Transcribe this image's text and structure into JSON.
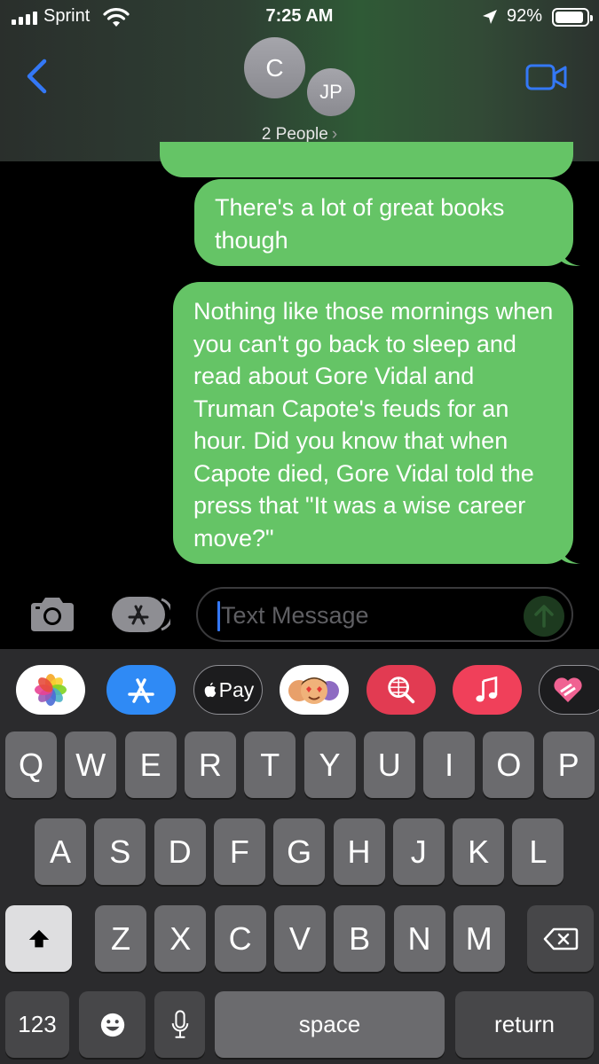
{
  "status_bar": {
    "carrier": "Sprint",
    "time": "7:25 AM",
    "battery_percent": "92%",
    "battery_level": 0.92
  },
  "conversation": {
    "avatar_c": "C",
    "avatar_jp": "JP",
    "people_label": "2 People",
    "people_chevron": "›"
  },
  "messages": [
    {
      "text": "There's a lot of great books though"
    },
    {
      "text": "Nothing like those mornings when you can't go back to sleep and read about Gore Vidal and Truman Capote's feuds for an hour. Did you know that when Capote died, Gore Vidal told the press that \"It was a wise career move?\""
    }
  ],
  "input": {
    "placeholder": "Text Message"
  },
  "apps": {
    "apple_pay": "Pay"
  },
  "keyboard": {
    "row1": [
      "Q",
      "W",
      "E",
      "R",
      "T",
      "Y",
      "U",
      "I",
      "O",
      "P"
    ],
    "row2": [
      "A",
      "S",
      "D",
      "F",
      "G",
      "H",
      "J",
      "K",
      "L"
    ],
    "row3": [
      "Z",
      "X",
      "C",
      "V",
      "B",
      "N",
      "M"
    ],
    "numbers": "123",
    "space": "space",
    "return": "return"
  },
  "colors": {
    "bubble": "#65c466",
    "accent": "#3478f6"
  },
  "icons": [
    "signal-icon",
    "wifi-icon",
    "location-icon",
    "battery-icon",
    "back-chevron-icon",
    "video-call-icon",
    "camera-icon",
    "app-store-icon",
    "send-arrow-icon",
    "photos-icon",
    "memoji-icon",
    "search-images-icon",
    "music-icon",
    "heart-icon",
    "shift-icon",
    "delete-icon",
    "emoji-icon",
    "microphone-icon"
  ]
}
